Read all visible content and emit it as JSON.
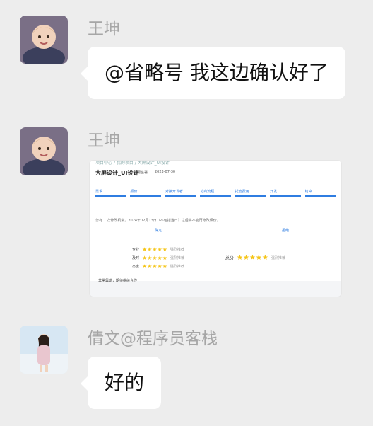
{
  "messages": [
    {
      "sender": "王坤",
      "text": "@省略号 我这边确认好了"
    },
    {
      "sender": "王坤",
      "card": {
        "breadcrumb": "项目中心 / 我的项目 / 大屏设计_UI设计",
        "title": "大屏设计_UI设计",
        "subtitle": "需要签署",
        "date": "2023-07-30",
        "steps": [
          "需求",
          "报价",
          "对接开发者",
          "协商流程",
          "托管费用",
          "开发",
          "结算"
        ],
        "note": "您有 1 次修改机会。2024年02月13日（不包括当日）之后将不能再修改评价。",
        "col1": "确定",
        "col2": "拒绝",
        "ratings": [
          {
            "label": "专业",
            "stars": "★★★★★",
            "hint": "强烈推荐"
          },
          {
            "label": "及时",
            "stars": "★★★★★",
            "hint": "强烈推荐"
          },
          {
            "label": "态度",
            "stars": "★★★★★",
            "hint": "强烈推荐"
          }
        ],
        "total_label": "总分",
        "total_stars": "★★★★★",
        "total_hint": "强烈推荐",
        "comment": "非常靠谱，期待继续合作"
      }
    },
    {
      "sender": "倩文@程序员客栈",
      "text": "好的"
    }
  ]
}
